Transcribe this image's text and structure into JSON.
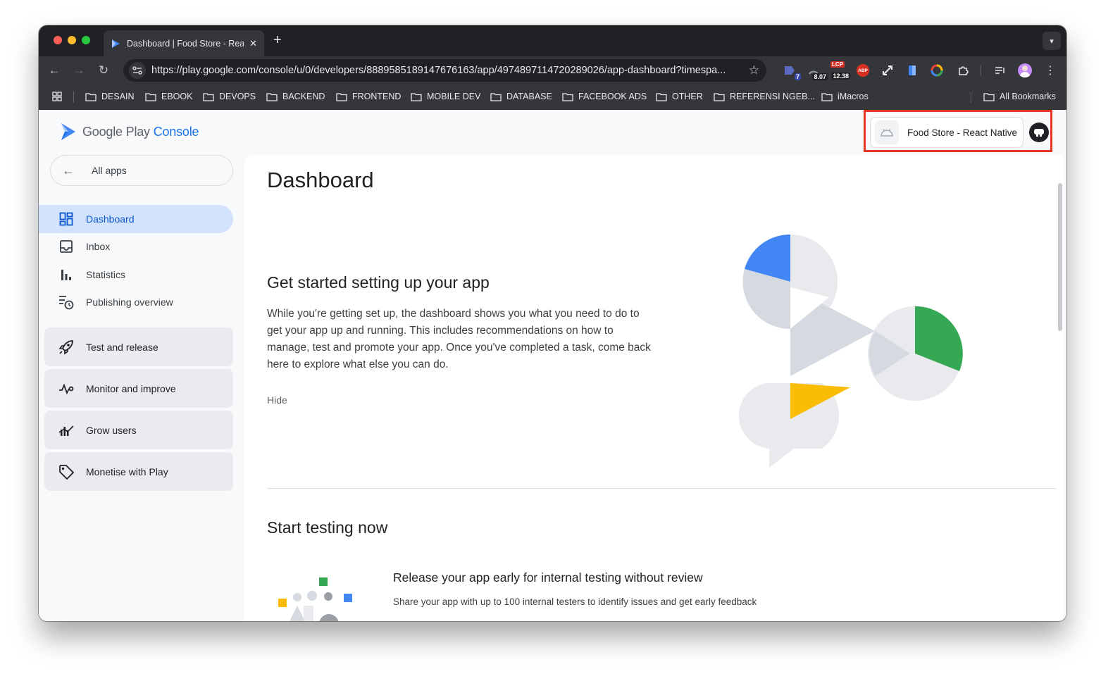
{
  "browser": {
    "tab_title": "Dashboard | Food Store - Rea",
    "url": "https://play.google.com/console/u/0/developers/8889585189147676163/app/4974897114720289026/app-dashboard?timespa...",
    "extension_badges": {
      "ext1": "7",
      "ext2": "8.07",
      "ext3_top": "LCP",
      "ext3": "12.38",
      "ext4": "ABP"
    },
    "bookmarks": [
      "DESAIN",
      "EBOOK",
      "DEVOPS",
      "BACKEND",
      "FRONTEND",
      "MOBILE DEV",
      "DATABASE",
      "FACEBOOK ADS",
      "OTHER",
      "REFERENSI NGEB...",
      "iMacros"
    ],
    "all_bookmarks": "All Bookmarks"
  },
  "header": {
    "logo_text": "Google Play",
    "logo_console": "Console",
    "app_selector": "Food Store - React Native"
  },
  "sidebar": {
    "all_apps": "All apps",
    "items": [
      {
        "label": "Dashboard",
        "icon": "dashboard-icon",
        "active": true
      },
      {
        "label": "Inbox",
        "icon": "inbox-icon"
      },
      {
        "label": "Statistics",
        "icon": "bar-chart-icon"
      },
      {
        "label": "Publishing overview",
        "icon": "publishing-schedule-icon"
      }
    ],
    "groups": [
      {
        "label": "Test and release",
        "icon": "rocket-icon"
      },
      {
        "label": "Monitor and improve",
        "icon": "vitals-icon"
      },
      {
        "label": "Grow users",
        "icon": "grow-icon"
      },
      {
        "label": "Monetise with Play",
        "icon": "tag-icon"
      }
    ]
  },
  "main": {
    "title": "Dashboard",
    "setup": {
      "heading": "Get started setting up your app",
      "description": "While you're getting set up, the dashboard shows you what you need to do to get your app up and running. This includes recommendations on how to manage, test and promote your app. Once you've completed a task, come back here to explore what else you can do.",
      "hide": "Hide"
    },
    "testing": {
      "heading": "Start testing now",
      "card_title": "Release your app early for internal testing without review",
      "card_desc": "Share your app with up to 100 internal testers to identify issues and get early feedback"
    }
  },
  "colors": {
    "accent_blue": "#1a73e8",
    "nav_active_bg": "#d3e3fd",
    "annotation_red": "#e53522",
    "google_green": "#34a853",
    "google_yellow": "#fbbc04",
    "google_blue": "#4285f4"
  }
}
